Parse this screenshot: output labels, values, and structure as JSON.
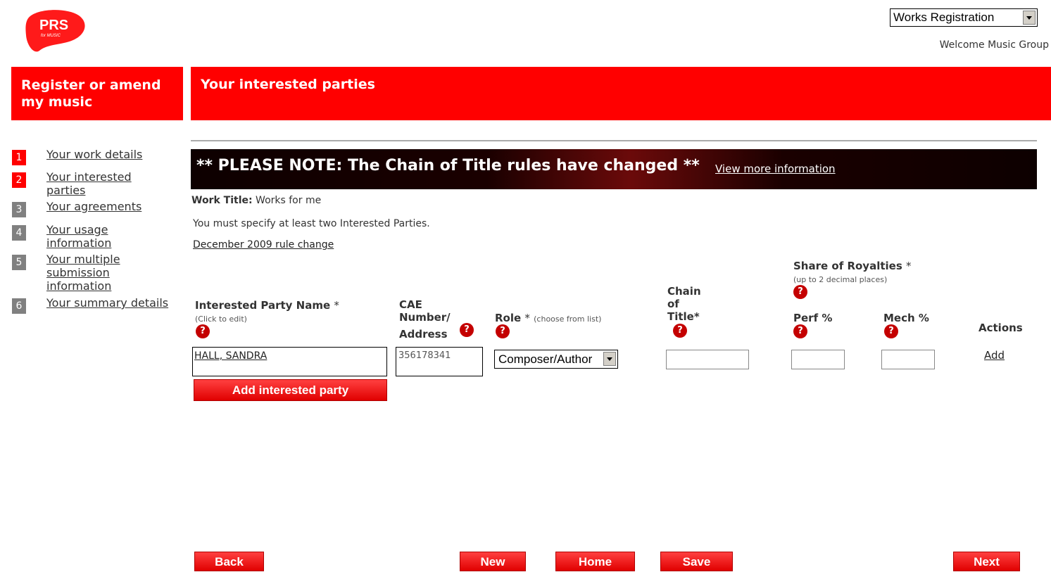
{
  "logo": {
    "main": "PRS",
    "sub": "for MUSIC"
  },
  "top_select": {
    "value": "Works Registration"
  },
  "welcome": "Welcome Music Group",
  "banner_left": "Register or amend my music",
  "banner_right": "Your interested parties",
  "steps": [
    {
      "num": "1",
      "label": "Your work details",
      "state": "done"
    },
    {
      "num": "2",
      "label": "Your interested parties",
      "state": "current"
    },
    {
      "num": "3",
      "label": "Your agreements",
      "state": "todo"
    },
    {
      "num": "4",
      "label": "Your usage information",
      "state": "todo"
    },
    {
      "num": "5",
      "label": "Your multiple submission information",
      "state": "todo"
    },
    {
      "num": "6",
      "label": "Your summary details",
      "state": "todo"
    }
  ],
  "notice": {
    "text": "** PLEASE NOTE: The Chain of Title rules have changed **",
    "link": "View more information"
  },
  "work_title": {
    "label": "Work Title:",
    "value": "Works for me"
  },
  "instruction": "You must specify at least two Interested Parties.",
  "rule_change_link": "December 2009 rule change",
  "columns": {
    "ip_name": "Interested Party Name",
    "ip_name_req": "*",
    "ip_name_hint": "(Click to edit)",
    "cae_1": "CAE",
    "cae_2": "Number/",
    "cae_3": "Address",
    "role": "Role",
    "role_req": "*",
    "role_hint": "(choose from list)",
    "chain_1": "Chain",
    "chain_2": "of",
    "chain_3": "Title*",
    "share": "Share of Royalties",
    "share_req": "*",
    "share_hint": "(up to 2 decimal places)",
    "perf": "Perf %",
    "mech": "Mech %",
    "actions": "Actions"
  },
  "row": {
    "name": "HALL, SANDRA",
    "cae": "356178341",
    "role": "Composer/Author",
    "chain": "",
    "perf": "",
    "mech": "",
    "action": "Add"
  },
  "add_party_button": "Add interested party",
  "footer_buttons": {
    "back": "Back",
    "new": "New",
    "home": "Home",
    "save": "Save",
    "next": "Next"
  },
  "colors": {
    "brand_red": "#ff0000",
    "help_red": "#c40000",
    "step_gray": "#808080"
  },
  "icons": {
    "help": "help-icon",
    "dropdown": "chevron-down-icon"
  }
}
